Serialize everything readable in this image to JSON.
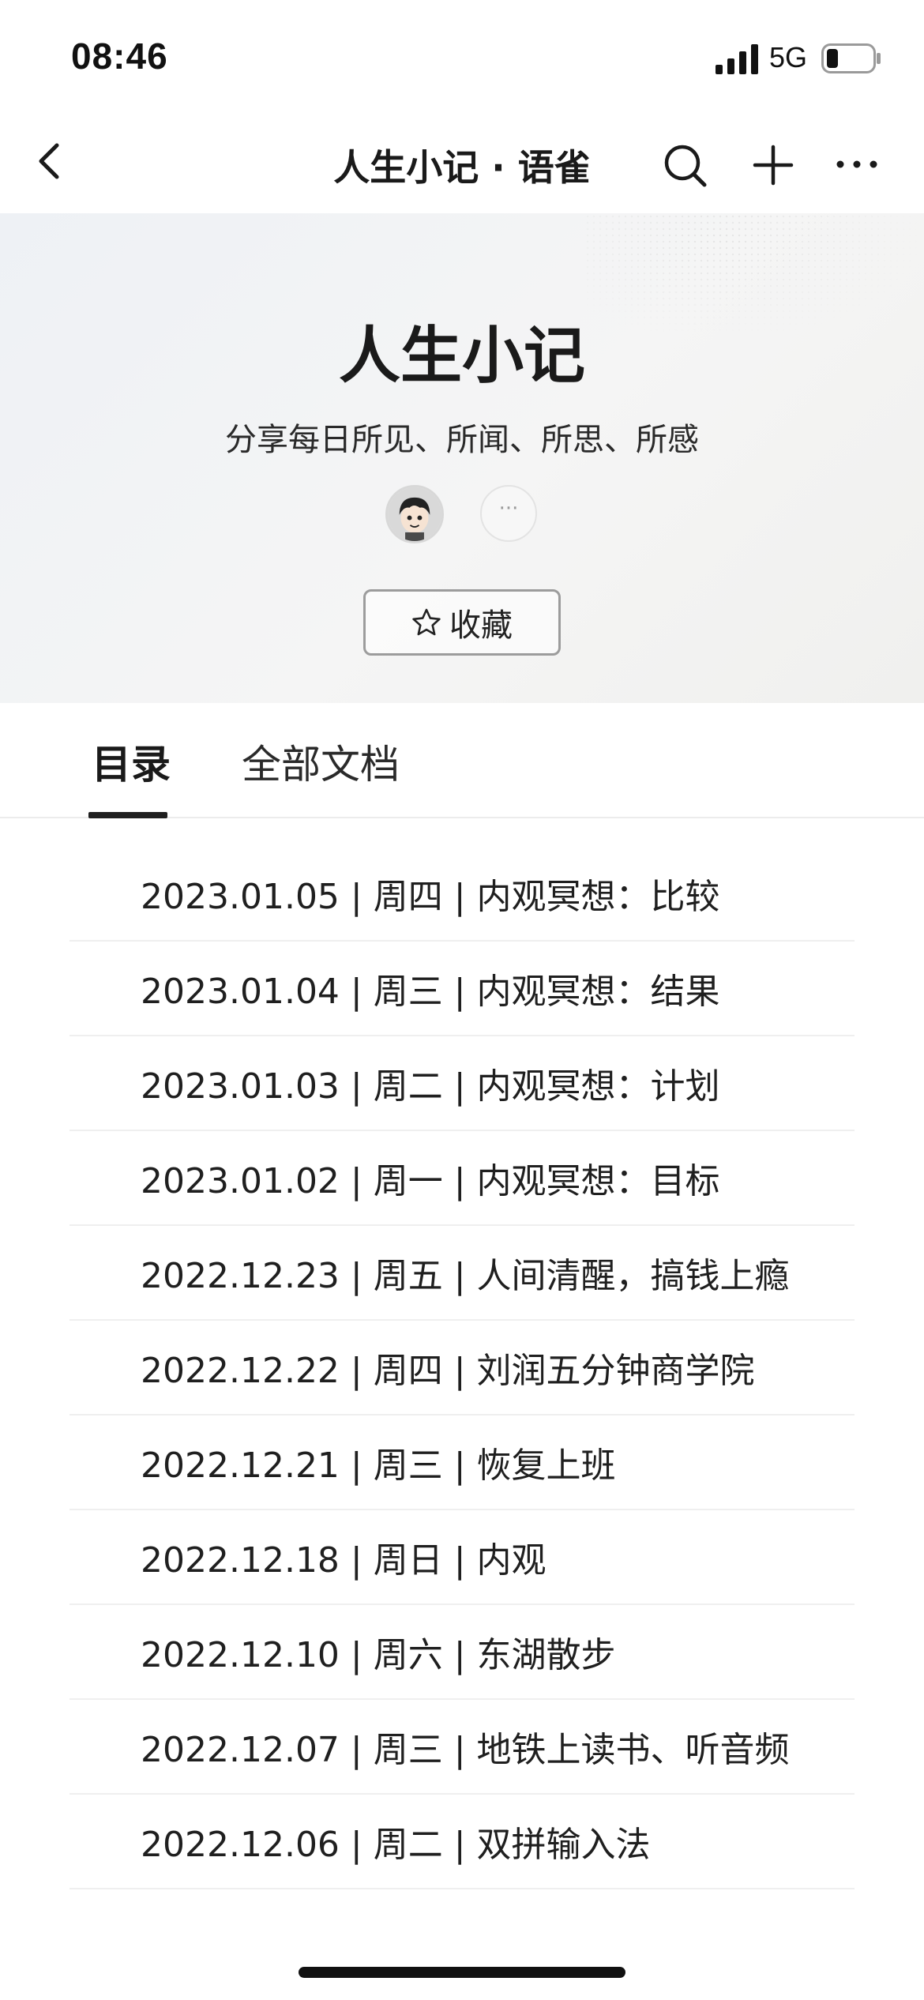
{
  "status_bar": {
    "time": "08:46",
    "network": "5G",
    "battery_level": 0.25
  },
  "nav": {
    "title": "人生小记 · 语雀",
    "icons": [
      "back-icon",
      "search-icon",
      "add-icon",
      "more-icon"
    ]
  },
  "book": {
    "title": "人生小记",
    "description": "分享每日所见、所闻、所思、所感",
    "more_members_label": "···",
    "collect_label": "收藏"
  },
  "tabs": [
    {
      "label": "目录",
      "active": true
    },
    {
      "label": "全部文档",
      "active": false
    }
  ],
  "documents": [
    "2023.01.05 | 周四 | 内观冥想：比较",
    "2023.01.04 | 周三 | 内观冥想：结果",
    "2023.01.03 | 周二 | 内观冥想：计划",
    "2023.01.02 | 周一 | 内观冥想：目标",
    "2022.12.23 | 周五 | 人间清醒，搞钱上瘾",
    "2022.12.22 | 周四 | 刘润五分钟商学院",
    "2022.12.21 | 周三 | 恢复上班",
    "2022.12.18 | 周日 | 内观",
    "2022.12.10 | 周六 | 东湖散步",
    "2022.12.07 | 周三 | 地铁上读书、听音频",
    "2022.12.06 | 周二 | 双拼输入法"
  ],
  "colors": {
    "text_primary": "#1f1f1f",
    "tab_indicator": "#1f1f1f",
    "divider": "#efefef"
  }
}
